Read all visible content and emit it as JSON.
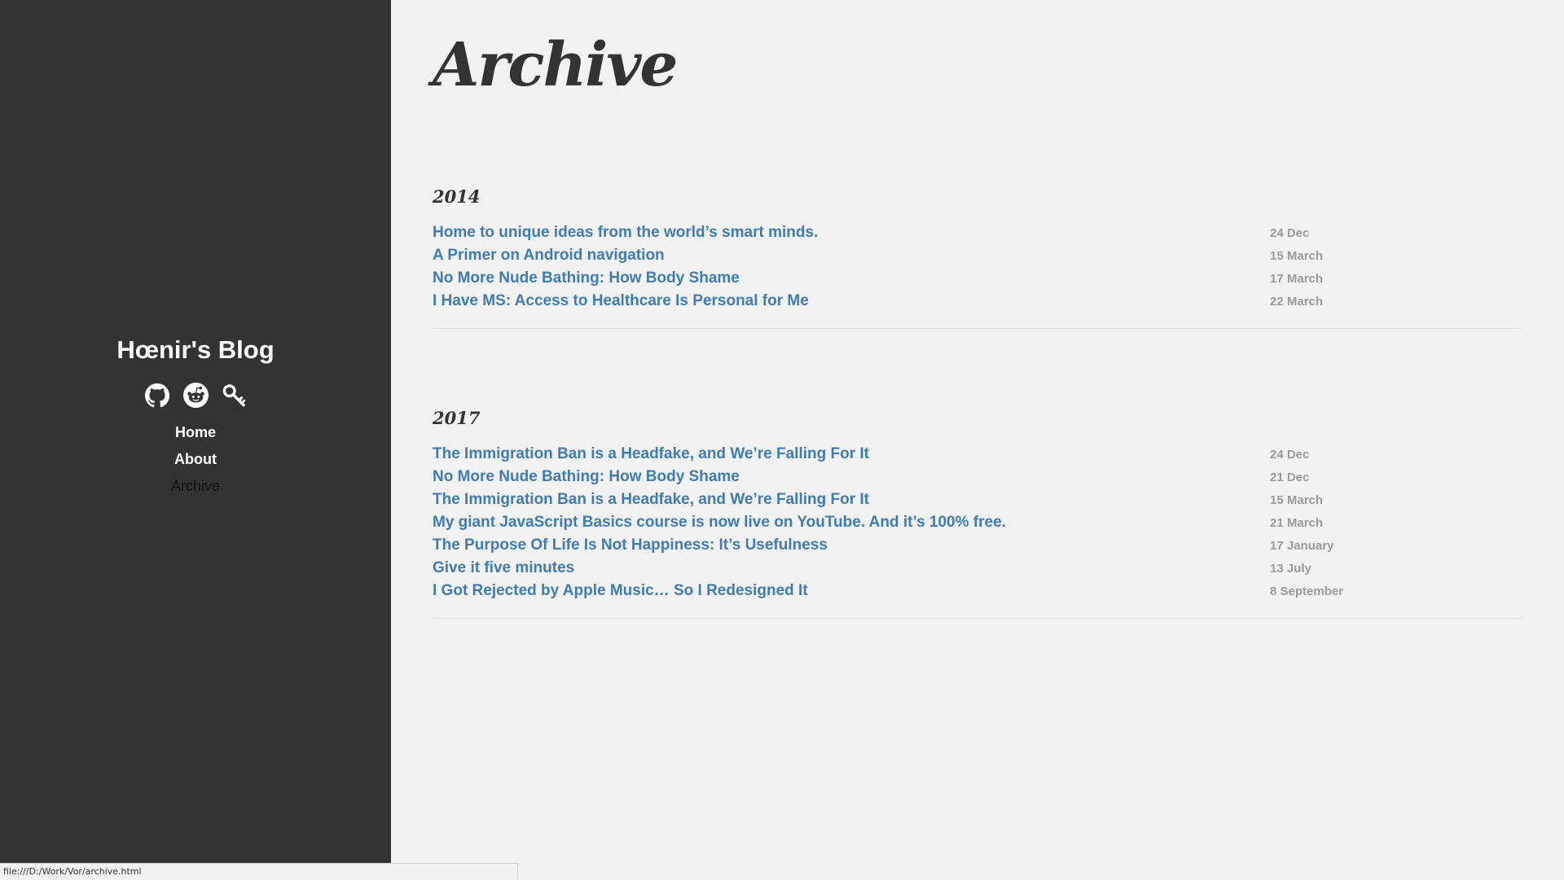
{
  "sidebar": {
    "blog_title": "Hœnir's Blog",
    "social_icons": [
      "github-icon",
      "reddit-icon",
      "key-icon"
    ],
    "nav": [
      {
        "label": "Home",
        "active": false
      },
      {
        "label": "About",
        "active": false
      },
      {
        "label": "Archive",
        "active": true
      }
    ]
  },
  "main": {
    "title": "Archive",
    "years": [
      {
        "year": "2014",
        "posts": [
          {
            "title": "Home to unique ideas from the world’s smart minds.",
            "date": "24 Dec"
          },
          {
            "title": "A Primer on Android navigation",
            "date": "15 March"
          },
          {
            "title": "No More Nude Bathing: How Body Shame",
            "date": "17 March"
          },
          {
            "title": "I Have MS: Access to Healthcare Is Personal for Me",
            "date": "22 March"
          }
        ]
      },
      {
        "year": "2017",
        "posts": [
          {
            "title": "The Immigration Ban is a Headfake, and We’re Falling For It",
            "date": "24 Dec"
          },
          {
            "title": "No More Nude Bathing: How Body Shame",
            "date": "21 Dec"
          },
          {
            "title": "The Immigration Ban is a Headfake, and We’re Falling For It",
            "date": "15 March"
          },
          {
            "title": "My giant JavaScript Basics course is now live on YouTube. And it’s 100% free.",
            "date": "21 March"
          },
          {
            "title": "The Purpose Of Life Is Not Happiness: It’s Usefulness",
            "date": "17 January"
          },
          {
            "title": "Give it five minutes",
            "date": "13 July"
          },
          {
            "title": "I Got Rejected by Apple Music… So I Redesigned It",
            "date": "8 September"
          }
        ]
      }
    ]
  },
  "status_bar": {
    "url": "file:///D:/Work/Vor/archive.html"
  },
  "colors": {
    "sidebar_bg": "#333333",
    "page_bg": "#f2f2f2",
    "link": "#3f7bb6",
    "date": "#9a9a9a"
  }
}
